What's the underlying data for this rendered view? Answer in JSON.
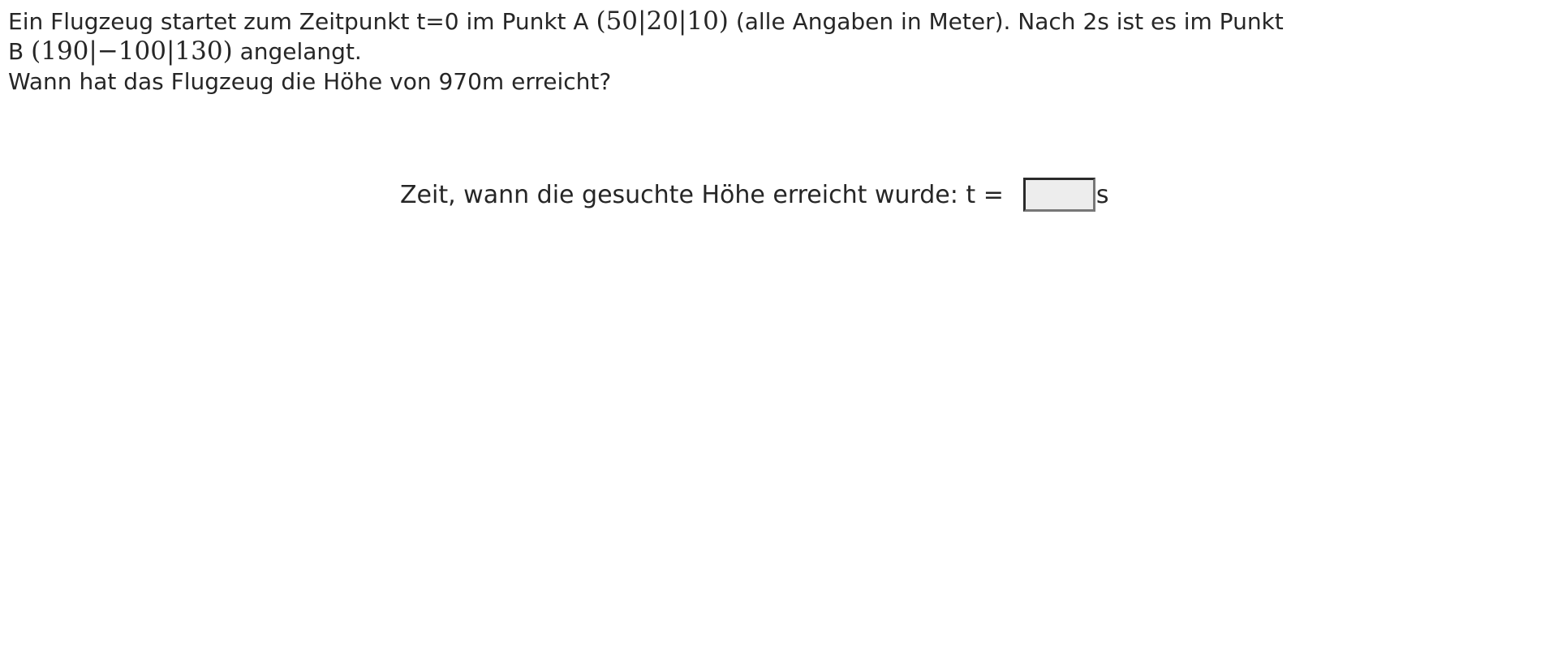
{
  "problem": {
    "sentence1_text_a": "Ein Flugzeug startet zum Zeitpunkt t=0 im Punkt A",
    "point_a": "(50|20|10)",
    "sentence1_text_b": "(alle Angaben in Meter). Nach 2s ist es im Punkt B",
    "point_b": "(190|−100|130)",
    "sentence1_text_c": "angelangt.",
    "question": "Wann hat das Flugzeug die Höhe von 970m erreicht?"
  },
  "answer": {
    "prompt": "Zeit, wann die gesuchte Höhe erreicht wurde: t =",
    "value": "",
    "unit": "s"
  }
}
